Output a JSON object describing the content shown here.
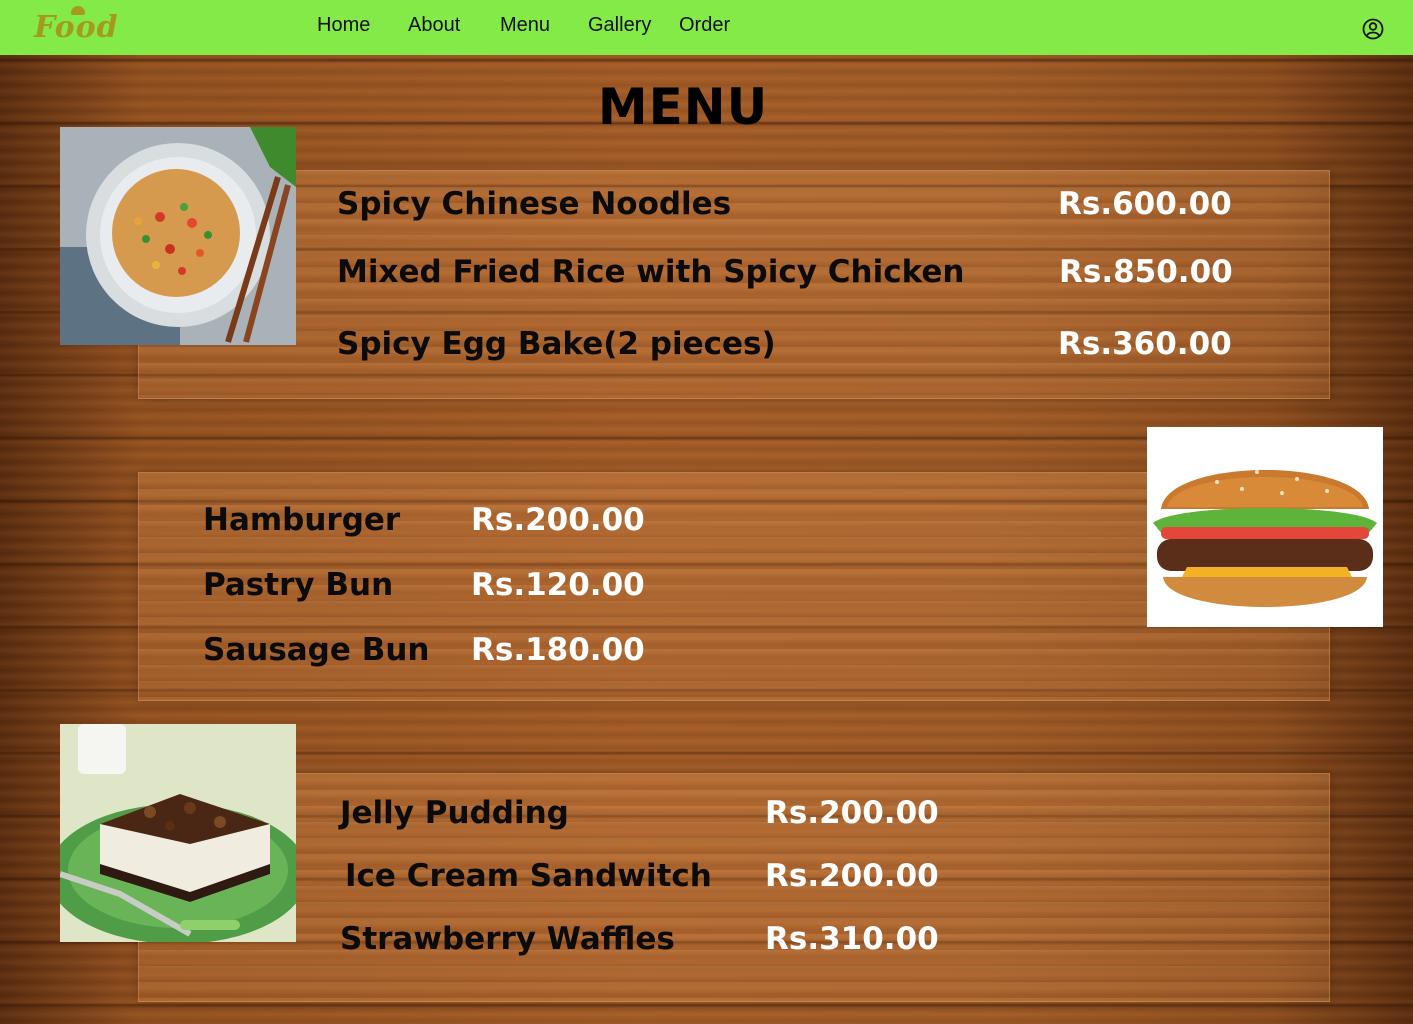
{
  "brand": {
    "logo_text": "Food"
  },
  "nav": {
    "items": [
      "Home",
      "About",
      "Menu",
      "Gallery",
      "Order"
    ]
  },
  "page": {
    "title": "MENU"
  },
  "sections": [
    {
      "items": [
        {
          "name": "Spicy Chinese Noodles",
          "price": "Rs.600.00"
        },
        {
          "name": "Mixed Fried Rice with Spicy Chicken",
          "price": "Rs.850.00"
        },
        {
          "name": "Spicy Egg Bake(2 pieces)",
          "price": "Rs.360.00"
        }
      ]
    },
    {
      "items": [
        {
          "name": "Hamburger",
          "price": "Rs.200.00"
        },
        {
          "name": "Pastry Bun",
          "price": "Rs.120.00"
        },
        {
          "name": "Sausage Bun",
          "price": "Rs.180.00"
        }
      ]
    },
    {
      "items": [
        {
          "name": "Jelly Pudding",
          "price": "Rs.200.00"
        },
        {
          "name": "Ice Cream Sandwitch",
          "price": "Rs.200.00"
        },
        {
          "name": "Strawberry Waffles",
          "price": "Rs.310.00"
        }
      ]
    }
  ],
  "colors": {
    "navbar": "#83ea47",
    "logo": "#a49a1f",
    "price": "#ffffff",
    "item": "#0b0b0b"
  },
  "icons": [
    "user-circle-icon"
  ]
}
